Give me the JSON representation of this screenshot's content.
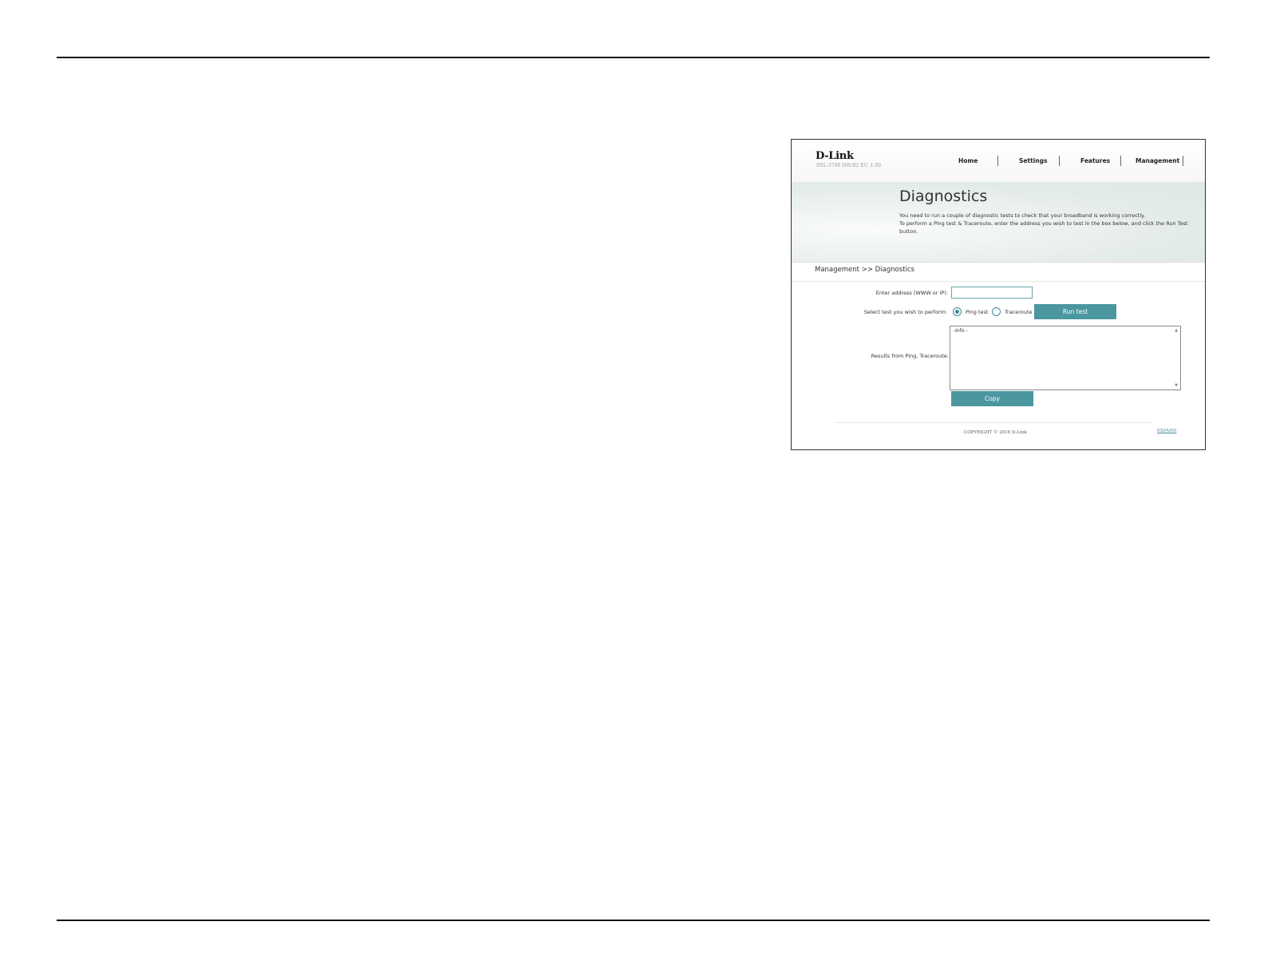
{
  "router": {
    "brand": "D-Link",
    "model": "DSL-3788 HW:B2 EU_1.00",
    "nav": [
      "Home",
      "Settings",
      "Features",
      "Management"
    ],
    "page_title": "Diagnostics",
    "description": [
      "You need to run a couple of diagnostic tests to check that your broadband is working correctly.",
      "To perform a Ping test & Traceroute, enter the address you wish to test in the box below, and click the Run Test",
      "button."
    ],
    "breadcrumb": "Management >> Diagnostics",
    "form": {
      "address_label": "Enter address (WWW or IP):",
      "address_value": "",
      "test_label": "Select test you wish to perform:",
      "options": [
        {
          "label": "Ping test",
          "selected": true
        },
        {
          "label": "Traceroute",
          "selected": false
        }
      ],
      "run_button": "Run test",
      "results_label": "Results from Ping, Traceroute:",
      "results_text": "-Info -",
      "copy_button": "Copy"
    },
    "footer": {
      "copyright": "COPYRIGHT © 2016 D-Link",
      "link": "EXPAND"
    },
    "colors": {
      "accent": "#4b97a0",
      "input_border": "#6aa3ab"
    }
  }
}
